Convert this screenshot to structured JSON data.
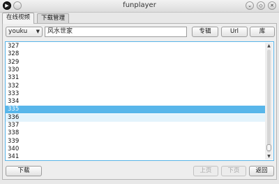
{
  "window": {
    "title": "funplayer"
  },
  "tabs": [
    {
      "label": "在线视频"
    },
    {
      "label": "下载管理"
    }
  ],
  "toolbar": {
    "source_selected": "youku",
    "search_value": "风水世家",
    "album_button": "专辑",
    "url_button": "Url",
    "library_button": "库"
  },
  "episodes": [
    "327",
    "328",
    "329",
    "330",
    "331",
    "332",
    "333",
    "334",
    "335",
    "336",
    "337",
    "338",
    "339",
    "340",
    "341"
  ],
  "selected_episode": "335",
  "bottom": {
    "download_button": "下载",
    "prev_button": "上页",
    "next_button": "下页",
    "back_button": "返回"
  },
  "list_scroll_position": 0.97
}
